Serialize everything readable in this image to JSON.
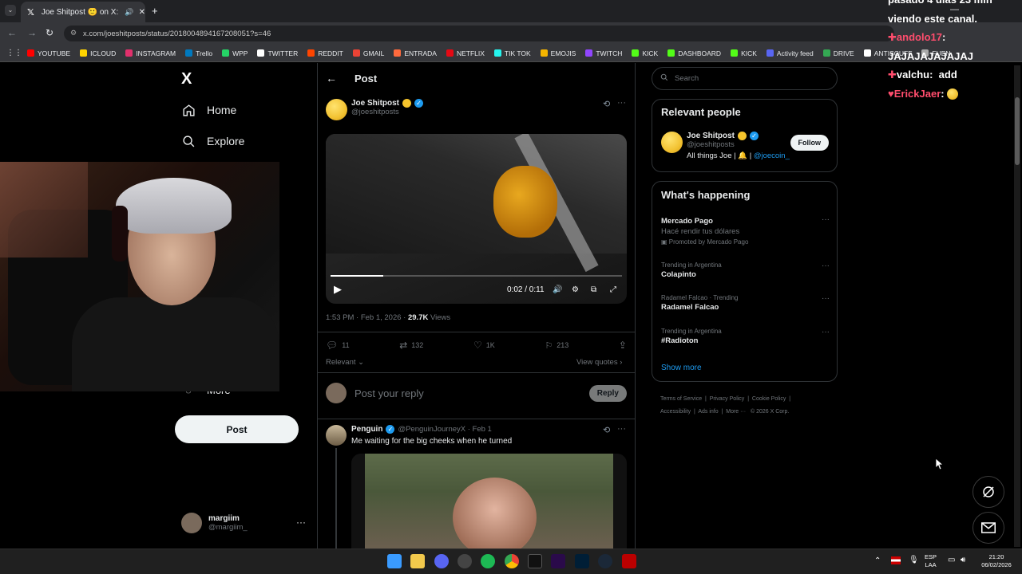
{
  "browser": {
    "tab_title": "Joe Shitpost 🙂 on X: \"http",
    "url": "x.com/joeshitposts/status/2018004894167208051?s=46",
    "bookmarks": [
      "YOUTUBE",
      "ICLOUD",
      "INSTAGRAM",
      "Trello",
      "WPP",
      "TWITTER",
      "REDDIT",
      "GMAIL",
      "ENTRADA",
      "NETFLIX",
      "TIK TOK",
      "EMOJIS",
      "TWITCH",
      "KICK",
      "DASHBOARD",
      "KICK",
      "Activity feed",
      "DRIVE",
      "ANTISCUFF",
      "FUEN"
    ],
    "bookmark_colors": [
      "#ff0000",
      "#ffd400",
      "#e1306c",
      "#0079bf",
      "#25d366",
      "#ffffff",
      "#ff4500",
      "#ea4335",
      "#ff6a3d",
      "#e50914",
      "#25f4ee",
      "#f4b400",
      "#9146ff",
      "#53fc18",
      "#53fc18",
      "#53fc18",
      "#5865f2",
      "#34a853",
      "#ffffff",
      "#aaaaaa"
    ]
  },
  "sidebar": {
    "logo": "X",
    "home_label": "Home",
    "explore_label": "Explore",
    "more_label": "More",
    "post_button": "Post",
    "user_name": "margiim",
    "user_handle": "@margiim_"
  },
  "post": {
    "header": "Post",
    "author_name": "Joe Shitpost",
    "author_handle": "@joeshitposts",
    "video_time": "0:02 / 0:11",
    "video_progress": 0.18,
    "timestamp": "1:53 PM · Feb 1, 2026 · ",
    "views_count": "29.7K",
    "views_label": " Views",
    "replies": "11",
    "reposts": "132",
    "likes": "1K",
    "bookmarks": "213",
    "relevant_label": "Relevant",
    "view_quotes": "View quotes",
    "reply_placeholder": "Post your reply",
    "reply_button": "Reply"
  },
  "reply_tweet": {
    "author_name": "Penguin",
    "author_handle": "@PenguinJourneyX · Feb 1",
    "text": "Me waiting for the big cheeks when he turned"
  },
  "right": {
    "search_placeholder": "Search",
    "relevant_title": "Relevant people",
    "person_name": "Joe Shitpost",
    "person_handle": "@joeshitposts",
    "person_bio": "All things Joe | 🔔 | ",
    "person_bio_link": "@joecoin_",
    "follow_button": "Follow",
    "happening_title": "What's happening",
    "trends": [
      {
        "cat": "",
        "name": "Mercado Pago",
        "sub": "Hacé rendir tus dólares",
        "promo": "Promoted by Mercado Pago"
      },
      {
        "cat": "Trending in Argentina",
        "name": "Colapinto"
      },
      {
        "cat": "Radamel Falcao · Trending",
        "name": "Radamel Falcao"
      },
      {
        "cat": "Trending in Argentina",
        "name": "#Radioton"
      }
    ],
    "show_more": "Show more",
    "footer": [
      "Terms of Service",
      "Privacy Policy",
      "Cookie Policy",
      "Accessibility",
      "Ads info",
      "More ···",
      "© 2026 X Corp."
    ]
  },
  "chat": {
    "line1": "pasado 4 días 23 min",
    "line2": "viendo este canal.",
    "user1": "andolo17",
    "msg1": "JAJAJAJAJAJAJ",
    "user2": "valchu",
    "msg2": "add",
    "user3": "ErickJaer",
    "user1_color": "#ff4d6d",
    "user3_color": "#ff4d6d"
  },
  "taskbar": {
    "lang1": "ESP",
    "lang2": "LAA",
    "time": "21:20",
    "date": "06/02/2026"
  }
}
